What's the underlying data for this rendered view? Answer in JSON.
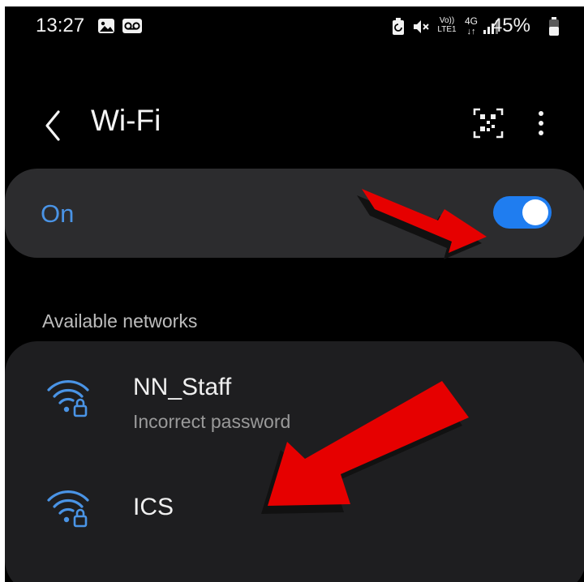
{
  "status_bar": {
    "time": "13:27",
    "battery": "45%",
    "icons": [
      "gallery-icon",
      "voicemail-icon",
      "battery-saver-icon",
      "mute-icon",
      "volte-icon",
      "4g-icon",
      "signal-icon",
      "battery-icon"
    ],
    "volte_label": "Vo)) LTE1",
    "network_type": "4G"
  },
  "header": {
    "title": "Wi-Fi",
    "icons": [
      "back-icon",
      "qr-code-icon",
      "more-options-icon"
    ]
  },
  "wifi_toggle": {
    "label": "On",
    "state": true,
    "accent_color": "#1f7df0"
  },
  "available": {
    "section_label": "Available networks",
    "networks": [
      {
        "name": "NN_Staff",
        "status": "Incorrect password",
        "icon": "wifi-lock-icon"
      },
      {
        "name": "ICS",
        "status": "",
        "icon": "wifi-lock-icon"
      }
    ]
  },
  "annotations": {
    "arrow_color": "#e60000",
    "arrows": [
      "arrow-to-toggle",
      "arrow-to-ics"
    ]
  }
}
